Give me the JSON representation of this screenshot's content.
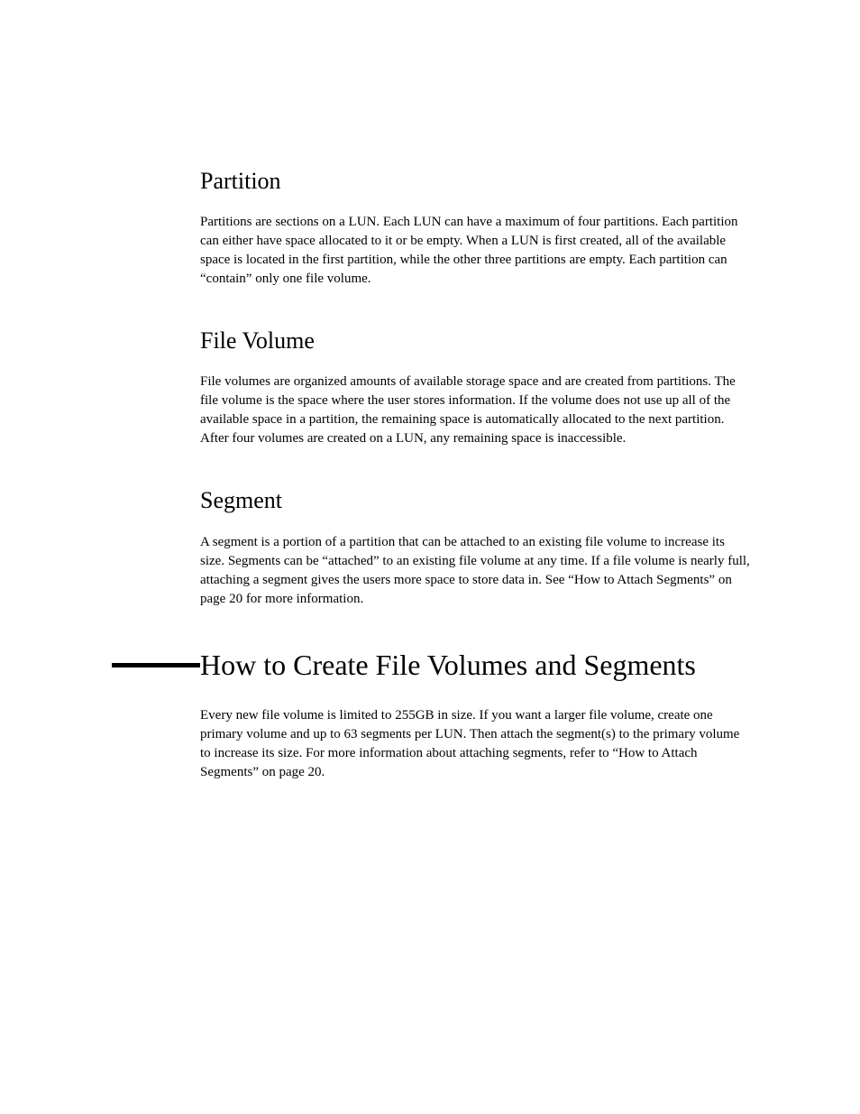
{
  "sections": {
    "partition": {
      "heading": "Partition",
      "body": "Partitions are sections on a LUN. Each LUN can have a maximum of four partitions. Each partition can either have space allocated to it or be empty. When a LUN is first created, all of the available space is located in the first partition, while the other three partitions are empty. Each partition can “contain” only one file volume."
    },
    "fileVolume": {
      "heading": "File Volume",
      "body": "File volumes are organized amounts of available storage space and are created from partitions. The file volume is the space where the user stores information. If the volume does not use up all of the available space in a partition, the remaining space is automatically allocated to the next partition. After four volumes are created on a LUN, any remaining space is inaccessible."
    },
    "segment": {
      "heading": "Segment",
      "body": "A segment is a portion of a partition that can be attached to an existing file volume to increase its size. Segments can be “attached” to an existing file volume at any time. If a file volume is nearly full, attaching a segment gives the users more space to store data in. See “How to Attach Segments” on page 20 for more information."
    },
    "howToCreate": {
      "heading": "How to Create File Volumes and Segments",
      "body": "Every new file volume is limited to 255GB in size. If you want a larger file volume, create one primary volume and up to 63 segments per LUN. Then attach the segment(s) to the primary volume to increase its size. For more information about attaching segments, refer to “How to Attach Segments” on page 20."
    }
  }
}
